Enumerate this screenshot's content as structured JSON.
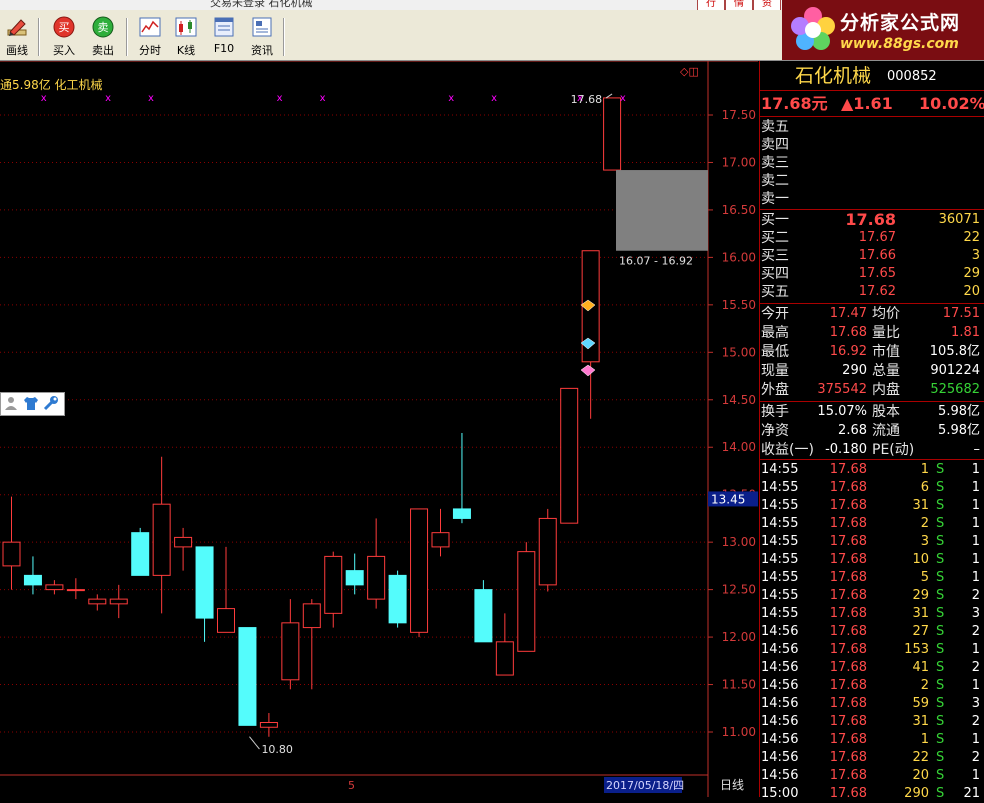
{
  "titlebar": {
    "title": "交易未登录   石化机械",
    "menu": [
      "行",
      "情",
      "资"
    ]
  },
  "toolbar": {
    "buttons": [
      {
        "label": "画线",
        "icon": "pencil-icon"
      },
      {
        "label": "买入",
        "icon": "buy-icon",
        "icon_text": "买"
      },
      {
        "label": "卖出",
        "icon": "sell-icon",
        "icon_text": "卖"
      },
      {
        "label": "分时",
        "icon": "intraday-icon"
      },
      {
        "label": "K线",
        "icon": "kline-icon"
      },
      {
        "label": "F10",
        "icon": "f10-icon"
      },
      {
        "label": "资讯",
        "icon": "news-icon"
      }
    ]
  },
  "logo": {
    "title": "分析家公式网",
    "url_text": "www.88gs.com"
  },
  "chart": {
    "info_text": "通5.98亿  化工机械",
    "price_ticks": [
      "17.50",
      "17.00",
      "16.50",
      "16.00",
      "15.50",
      "15.00",
      "14.50",
      "14.00",
      "13.50",
      "13.00",
      "12.50",
      "12.00",
      "11.50",
      "11.00"
    ],
    "current_price_label": "13.45",
    "high_label": "17.68",
    "low_label": "10.80",
    "box_label": "16.07 - 16.92",
    "x_tick_label": "5",
    "date_label": "2017/05/18/四",
    "period_label": "日线",
    "colors": {
      "up": "#ff3c3c",
      "down": "#54fcfc",
      "grid": "#8b0000",
      "box": "#808080",
      "marker": "#ff00ff"
    },
    "candles": [
      {
        "o": 12.75,
        "h": 13.48,
        "c": 13.0,
        "l": 12.5
      },
      {
        "o": 12.65,
        "h": 12.85,
        "c": 12.55,
        "l": 12.45
      },
      {
        "o": 12.5,
        "h": 12.6,
        "c": 12.55,
        "l": 12.45
      },
      {
        "o": 12.5,
        "h": 12.62,
        "c": 12.5,
        "l": 12.4
      },
      {
        "o": 12.35,
        "h": 12.45,
        "c": 12.4,
        "l": 12.28
      },
      {
        "o": 12.35,
        "h": 12.55,
        "c": 12.4,
        "l": 12.2
      },
      {
        "o": 13.1,
        "h": 13.15,
        "c": 12.65,
        "l": 12.65
      },
      {
        "o": 12.65,
        "h": 13.9,
        "c": 13.4,
        "l": 12.25
      },
      {
        "o": 12.95,
        "h": 13.15,
        "c": 13.05,
        "l": 12.7
      },
      {
        "o": 12.95,
        "h": 12.95,
        "c": 12.2,
        "l": 11.95
      },
      {
        "o": 12.05,
        "h": 12.95,
        "c": 12.3,
        "l": 12.05
      },
      {
        "o": 12.1,
        "h": 12.1,
        "c": 11.07,
        "l": 11.07
      },
      {
        "o": 11.05,
        "h": 11.2,
        "c": 11.1,
        "l": 10.95
      },
      {
        "o": 11.55,
        "h": 12.4,
        "c": 12.15,
        "l": 11.45
      },
      {
        "o": 12.1,
        "h": 12.4,
        "c": 12.35,
        "l": 11.45
      },
      {
        "o": 12.25,
        "h": 12.9,
        "c": 12.85,
        "l": 12.1
      },
      {
        "o": 12.7,
        "h": 12.88,
        "c": 12.55,
        "l": 12.45
      },
      {
        "o": 12.4,
        "h": 13.25,
        "c": 12.85,
        "l": 12.3
      },
      {
        "o": 12.65,
        "h": 12.7,
        "c": 12.15,
        "l": 12.1
      },
      {
        "o": 12.05,
        "h": 13.35,
        "c": 13.35,
        "l": 12.0
      },
      {
        "o": 12.95,
        "h": 13.35,
        "c": 13.1,
        "l": 12.85
      },
      {
        "o": 13.35,
        "h": 14.15,
        "c": 13.25,
        "l": 13.2
      },
      {
        "o": 12.5,
        "h": 12.6,
        "c": 11.95,
        "l": 11.95
      },
      {
        "o": 11.6,
        "h": 12.25,
        "c": 11.95,
        "l": 11.6
      },
      {
        "o": 11.85,
        "h": 13.0,
        "c": 12.9,
        "l": 11.85
      },
      {
        "o": 12.55,
        "h": 13.35,
        "c": 13.25,
        "l": 12.48
      },
      {
        "o": 13.2,
        "h": 14.62,
        "c": 14.62,
        "l": 13.2
      },
      {
        "o": 14.9,
        "h": 16.07,
        "c": 16.07,
        "l": 14.3
      },
      {
        "o": 16.92,
        "h": 17.68,
        "c": 17.68,
        "l": 16.92
      }
    ],
    "marker_glyph": "x"
  },
  "side_tools": {
    "icons": [
      "person-icon",
      "shirt-icon",
      "wrench-icon"
    ]
  },
  "quote": {
    "name": "石化机械",
    "code": "000852",
    "price": "17.68元",
    "change": "▲1.61",
    "pct": "10.02%",
    "sells": [
      {
        "label": "卖五"
      },
      {
        "label": "卖四"
      },
      {
        "label": "卖三"
      },
      {
        "label": "卖二"
      },
      {
        "label": "卖一"
      }
    ],
    "buys": [
      {
        "label": "买一",
        "price": "17.68",
        "vol": "36071"
      },
      {
        "label": "买二",
        "price": "17.67",
        "vol": "22"
      },
      {
        "label": "买三",
        "price": "17.66",
        "vol": "3"
      },
      {
        "label": "买四",
        "price": "17.65",
        "vol": "29"
      },
      {
        "label": "买五",
        "price": "17.62",
        "vol": "20"
      }
    ],
    "stats": [
      {
        "l1": "今开",
        "v1": "17.47",
        "c1": "red",
        "l2": "均价",
        "v2": "17.51",
        "c2": "red"
      },
      {
        "l1": "最高",
        "v1": "17.68",
        "c1": "red",
        "l2": "量比",
        "v2": "1.81",
        "c2": "red"
      },
      {
        "l1": "最低",
        "v1": "16.92",
        "c1": "red",
        "l2": "市值",
        "v2": "105.8亿",
        "c2": "wht"
      },
      {
        "l1": "现量",
        "v1": "290",
        "c1": "wht",
        "l2": "总量",
        "v2": "901224",
        "c2": "wht"
      },
      {
        "l1": "外盘",
        "v1": "375542",
        "c1": "red",
        "l2": "内盘",
        "v2": "525682",
        "c2": "grn"
      }
    ],
    "stats2": [
      {
        "l1": "换手",
        "v1": "15.07%",
        "c1": "wht",
        "l2": "股本",
        "v2": "5.98亿",
        "c2": "wht"
      },
      {
        "l1": "净资",
        "v1": "2.68",
        "c1": "wht",
        "l2": "流通",
        "v2": "5.98亿",
        "c2": "wht"
      },
      {
        "l1": "收益(一)",
        "v1": "-0.180",
        "c1": "wht",
        "l2": "PE(动)",
        "v2": "–",
        "c2": "wht"
      }
    ],
    "ticks": [
      {
        "time": "14:55",
        "price": "17.68",
        "vol": "1",
        "side": "S",
        "n": "1"
      },
      {
        "time": "14:55",
        "price": "17.68",
        "vol": "6",
        "side": "S",
        "n": "1"
      },
      {
        "time": "14:55",
        "price": "17.68",
        "vol": "31",
        "side": "S",
        "n": "1"
      },
      {
        "time": "14:55",
        "price": "17.68",
        "vol": "2",
        "side": "S",
        "n": "1"
      },
      {
        "time": "14:55",
        "price": "17.68",
        "vol": "3",
        "side": "S",
        "n": "1"
      },
      {
        "time": "14:55",
        "price": "17.68",
        "vol": "10",
        "side": "S",
        "n": "1"
      },
      {
        "time": "14:55",
        "price": "17.68",
        "vol": "5",
        "side": "S",
        "n": "1"
      },
      {
        "time": "14:55",
        "price": "17.68",
        "vol": "29",
        "side": "S",
        "n": "2"
      },
      {
        "time": "14:55",
        "price": "17.68",
        "vol": "31",
        "side": "S",
        "n": "3"
      },
      {
        "time": "14:56",
        "price": "17.68",
        "vol": "27",
        "side": "S",
        "n": "2"
      },
      {
        "time": "14:56",
        "price": "17.68",
        "vol": "153",
        "side": "S",
        "n": "1"
      },
      {
        "time": "14:56",
        "price": "17.68",
        "vol": "41",
        "side": "S",
        "n": "2"
      },
      {
        "time": "14:56",
        "price": "17.68",
        "vol": "2",
        "side": "S",
        "n": "1"
      },
      {
        "time": "14:56",
        "price": "17.68",
        "vol": "59",
        "side": "S",
        "n": "3"
      },
      {
        "time": "14:56",
        "price": "17.68",
        "vol": "31",
        "side": "S",
        "n": "2"
      },
      {
        "time": "14:56",
        "price": "17.68",
        "vol": "1",
        "side": "S",
        "n": "1"
      },
      {
        "time": "14:56",
        "price": "17.68",
        "vol": "22",
        "side": "S",
        "n": "2"
      },
      {
        "time": "14:56",
        "price": "17.68",
        "vol": "20",
        "side": "S",
        "n": "1"
      },
      {
        "time": "15:00",
        "price": "17.68",
        "vol": "290",
        "side": "S",
        "n": "21"
      }
    ]
  }
}
